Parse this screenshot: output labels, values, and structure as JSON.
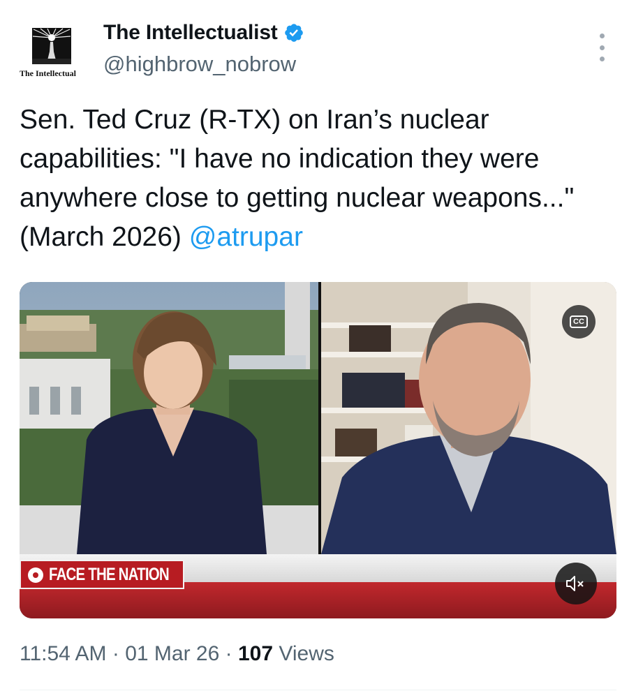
{
  "account": {
    "avatar_label": "The Intellectual",
    "name": "The Intellectualist",
    "handle": "@highbrow_nobrow",
    "verified": true
  },
  "tweet": {
    "text": "Sen. Ted Cruz (R-TX) on Iran’s nuclear capabilities: \"I have no indication they were anywhere close to getting nuclear weapons...\" (March 2026) ",
    "mention": "@atrupar"
  },
  "video": {
    "cc_label": "CC",
    "program_logo": "FACE THE NATION",
    "muted": true
  },
  "meta": {
    "time": "11:54 AM",
    "separator": "·",
    "date": "01 Mar 26",
    "views_count": "107",
    "views_label": "Views"
  },
  "colors": {
    "link": "#1d9bf0",
    "verified_badge": "#1d9bf0",
    "secondary_text": "#536471",
    "broadcast_red": "#b71c22"
  },
  "icons": [
    "verified-badge-icon",
    "more-options-icon",
    "closed-captions-icon",
    "volume-muted-icon",
    "cbs-eye-icon"
  ]
}
